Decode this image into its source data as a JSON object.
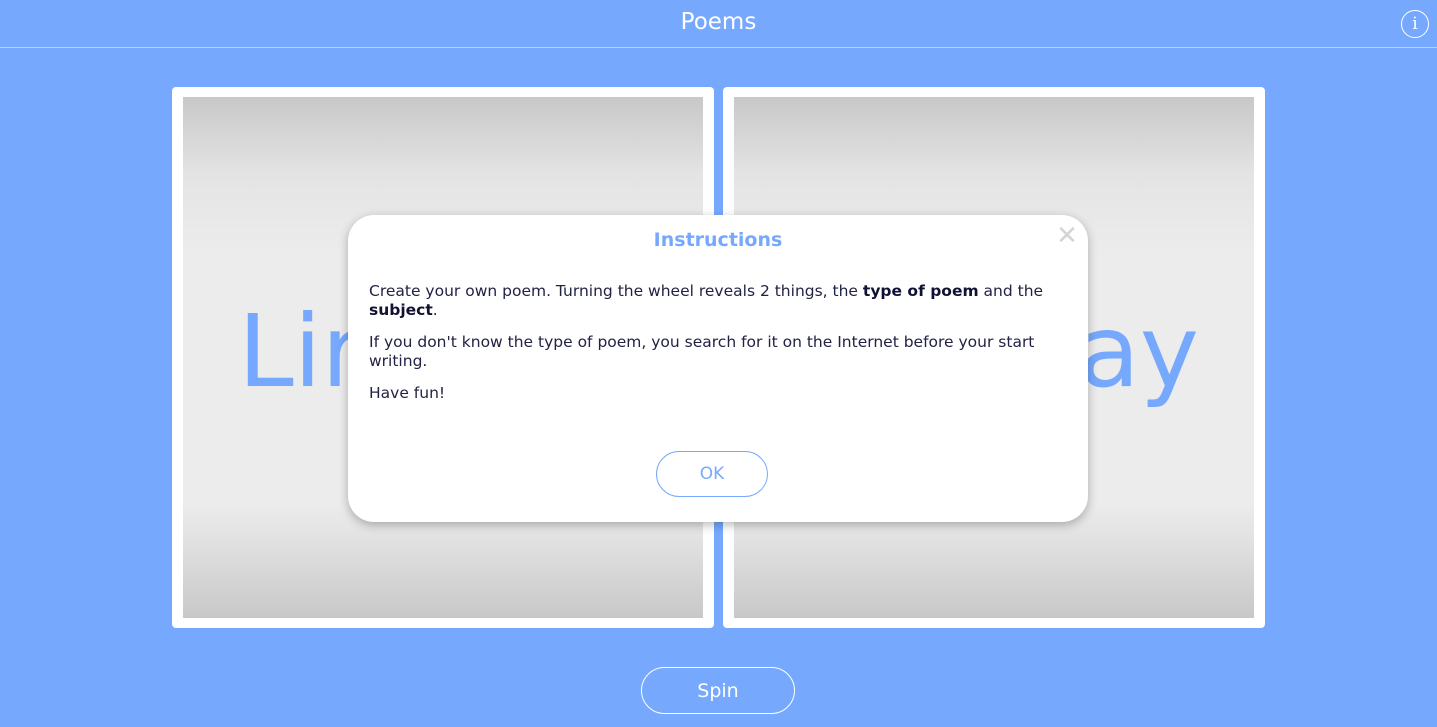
{
  "header": {
    "title": "Poems",
    "info_icon": "info-icon",
    "info_glyph": "i"
  },
  "reels": [
    {
      "word_visible": "Lir"
    },
    {
      "word_visible": "ay"
    }
  ],
  "modal": {
    "title": "Instructions",
    "close_glyph": "✕",
    "p1_a": "Create your own poem. Turning the wheel reveals 2 things, the ",
    "p1_bold1": "type of poem",
    "p1_b": " and the ",
    "p1_bold2": "subject",
    "p1_c": ".",
    "p2": "If you don't know the type of poem, you search for it on the Internet before your start writing.",
    "p3": "Have fun!",
    "ok_label": "OK"
  },
  "spin_label": "Spin",
  "colors": {
    "background": "#76a9fd",
    "accent": "#76a9fd",
    "panel": "#ffffff"
  }
}
